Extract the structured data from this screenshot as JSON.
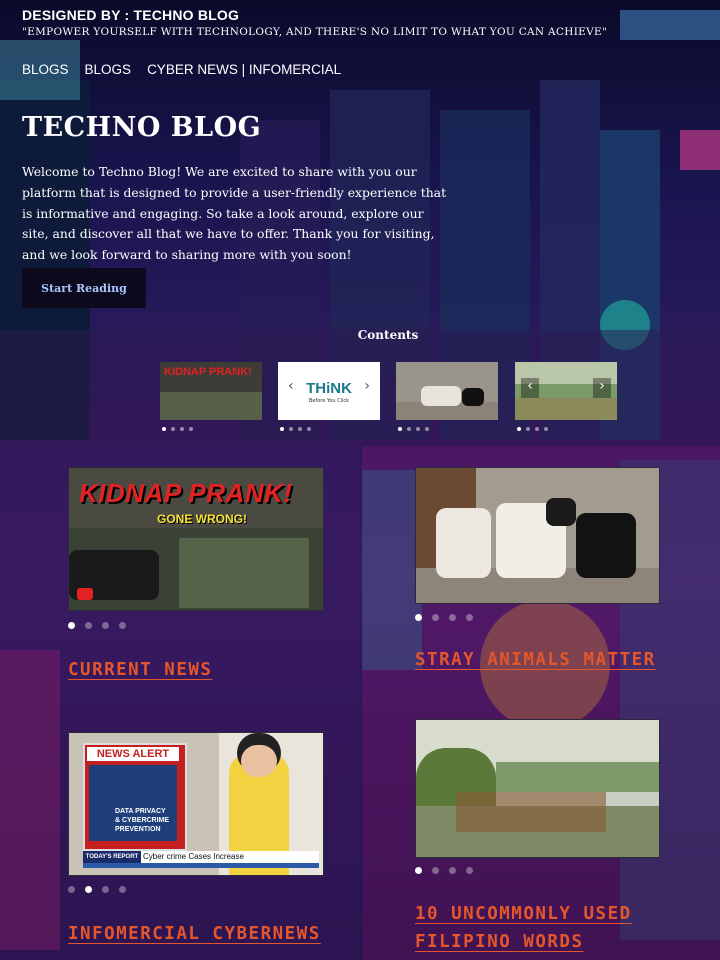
{
  "header": {
    "credit": "DESIGNED BY : TECHNO BLOG",
    "tagline": "\"EMPOWER YOURSELF WITH TECHNOLOGY, AND THERE'S NO LIMIT TO WHAT YOU CAN ACHIEVE\""
  },
  "nav": [
    {
      "label": "BLOGS"
    },
    {
      "label": "BLOGS"
    },
    {
      "label": "CYBER NEWS | INFOMERCIAL"
    }
  ],
  "hero": {
    "title": "TECHNO BLOG",
    "intro": "Welcome to Techno Blog! We are excited to share with you our platform that is designed to provide a user-friendly experience that is informative and engaging. So take a look around, explore our site, and discover all that we have to offer. Thank you for visiting, and we look forward to sharing more with you soon!",
    "cta_label": "Start Reading"
  },
  "contents": {
    "heading": "Contents",
    "thumbs": [
      {
        "caption": "KIDNAP PRANK!"
      },
      {
        "caption": "THiNK",
        "sub": "Before You Click"
      },
      {
        "caption": ""
      },
      {
        "caption": ""
      }
    ]
  },
  "cards": [
    {
      "title": "CURRENT NEWS",
      "image_text": "KIDNAP PRANK!",
      "image_sub": "GONE WRONG!"
    },
    {
      "title": "STRAY ANIMALS MATTER"
    },
    {
      "title": "INFOMERCIAL CYBERNEWS",
      "image_text": "NEWS ALERT",
      "image_lines": [
        "DATA PRIVACY",
        "& CYBERCRIME",
        "PREVENTION"
      ],
      "ticker_tag": "TODAY'S REPORT",
      "ticker": "Cyber crime Cases Increase"
    },
    {
      "title": "10 UNCOMMONLY USED FILIPINO WORDS"
    }
  ],
  "colors": {
    "accent": "#e4572c",
    "cta_text": "#a8c8ff",
    "bg": "#2a1150"
  }
}
